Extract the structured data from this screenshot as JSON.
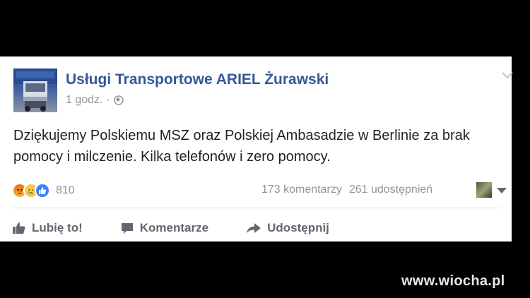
{
  "post": {
    "page_name": "Usługi Transportowe ARIEL Żurawski",
    "timestamp": "1 godz.",
    "separator": "·",
    "privacy_icon": "globe-icon",
    "menu_icon": "chevron-down-icon",
    "text": "Dziękujemy Polskiemu MSZ oraz Polskiej Ambasadzie w Berlinie za brak pomocy i milczenie. Kilka telefonów i zero pomocy."
  },
  "reactions": {
    "types": [
      "angry",
      "sad",
      "like"
    ],
    "count": "810"
  },
  "stats": {
    "comments": "173 komentarzy",
    "shares": "261 udostępnień"
  },
  "actions": {
    "like_label": "Lubię to!",
    "comment_label": "Komentarze",
    "share_label": "Udostępnij"
  },
  "colors": {
    "page_name": "#365899",
    "meta": "#90949c",
    "action": "#606770",
    "like_reaction": "#3e82f7",
    "angry_reaction": "#e9710f",
    "sad_reaction": "#f7c84a"
  },
  "watermark": "www.wiocha.pl"
}
